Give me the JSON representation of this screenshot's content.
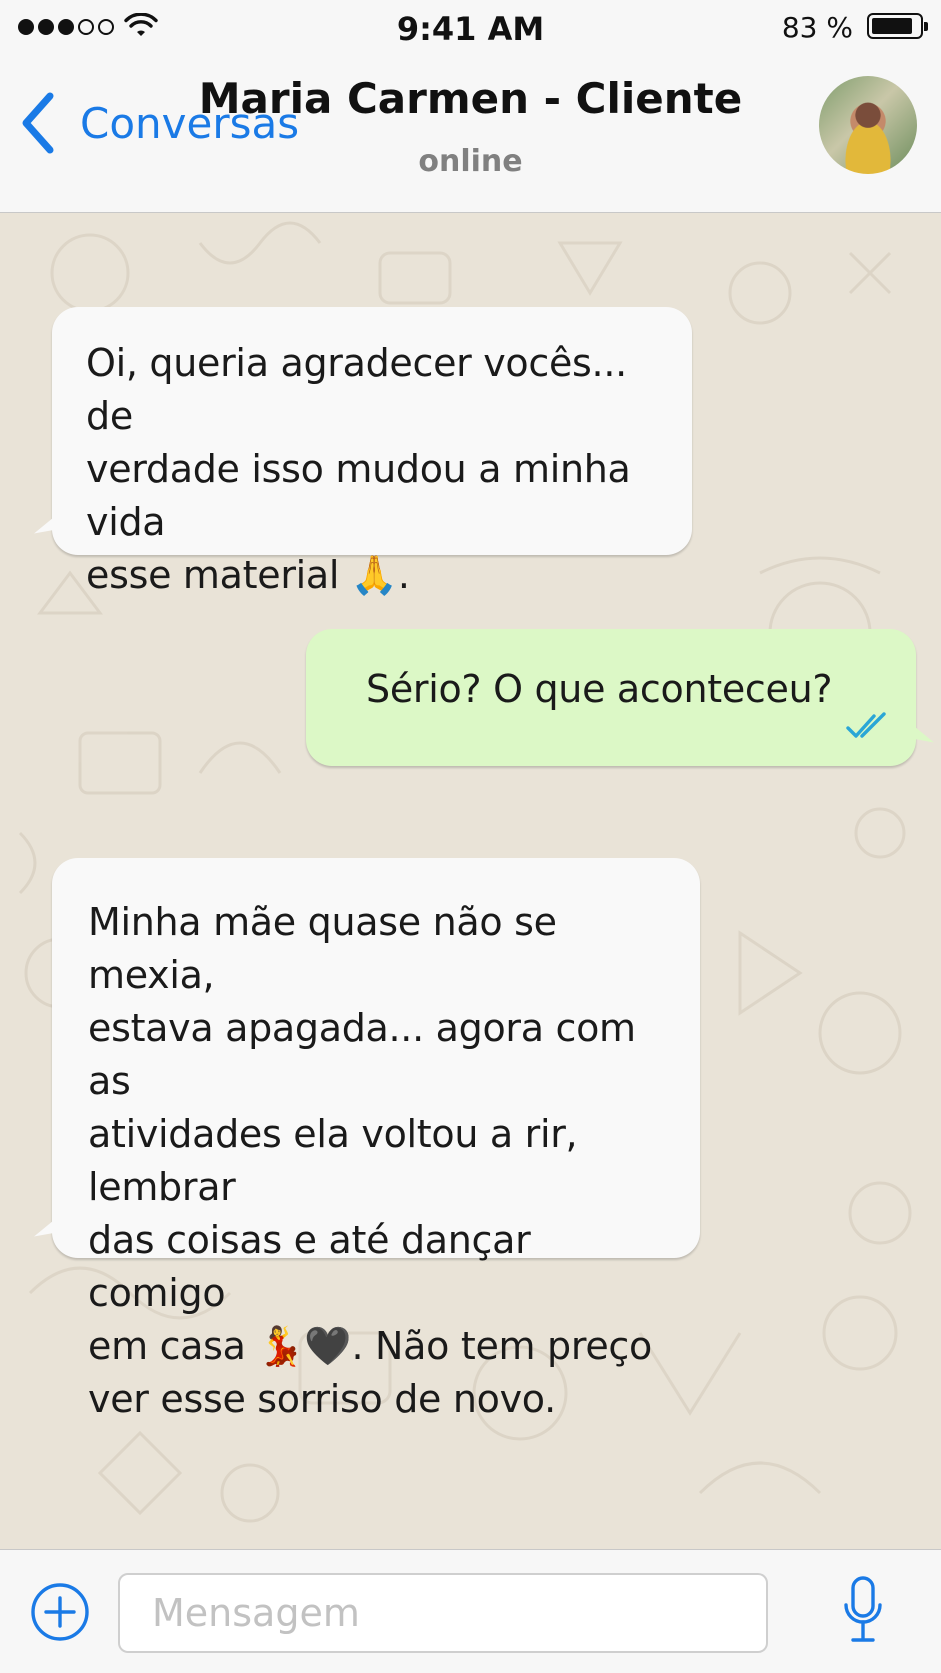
{
  "status_bar": {
    "time": "9:41 AM",
    "battery": "83 %",
    "signal_dots_filled": 3,
    "signal_dots_total": 5,
    "icons": [
      "signal-dots-icon",
      "wifi-icon",
      "battery-icon"
    ]
  },
  "header": {
    "back_label": "Conversas",
    "contact_name": "Maria Carmen - Cliente",
    "contact_status": "online",
    "icons": [
      "chevron-left-icon",
      "avatar"
    ]
  },
  "messages": [
    {
      "direction": "incoming",
      "lines": [
        "Oi, queria agradecer vocês... de",
        "verdade isso mudou a minha vida",
        "esse material 🙏."
      ]
    },
    {
      "direction": "outgoing",
      "lines": [
        "Sério? O que aconteceu?"
      ],
      "read_receipt": "double-check-icon"
    },
    {
      "direction": "incoming",
      "lines": [
        "Minha mãe quase não se mexia,",
        "estava apagada... agora com as",
        "atividades ela voltou a rir, lembrar",
        "das coisas e até dançar comigo",
        "em casa 💃🖤. Não tem preço",
        "ver esse sorriso de novo."
      ]
    }
  ],
  "input_bar": {
    "placeholder": "Mensagem",
    "value": "",
    "icons": [
      "plus-circle-icon",
      "microphone-icon"
    ]
  },
  "colors": {
    "accent": "#1a7ae6",
    "outgoing_bubble": "#dcf8c6",
    "incoming_bubble": "#f9f9f9",
    "chat_background": "#e9e3d7",
    "read_tick": "#2aa6d6"
  }
}
